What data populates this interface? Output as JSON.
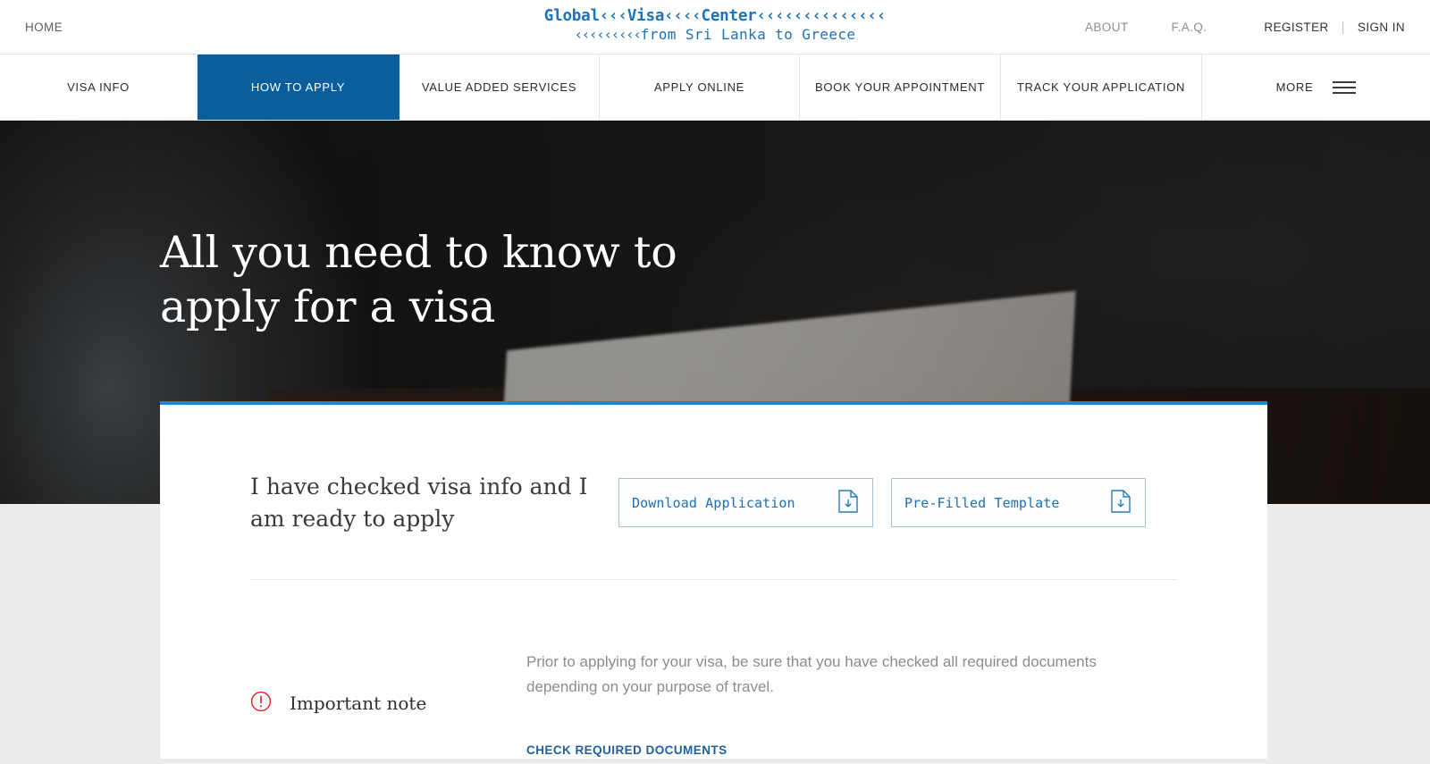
{
  "topbar": {
    "home_label": "HOME",
    "logo": {
      "line1_a": "Global",
      "line1_ch1": "‹‹‹",
      "line1_b": "Visa",
      "line1_ch2": "‹‹‹‹",
      "line1_c": "Center",
      "line1_ch3": "‹‹‹‹‹‹‹‹‹‹‹‹‹‹",
      "line2_ch": "‹‹‹‹‹‹‹‹‹",
      "line2_text": "from Sri Lanka to Greece"
    },
    "about_label": "ABOUT",
    "faq_label": "F.A.Q.",
    "register_label": "REGISTER",
    "separator": "|",
    "signin_label": "SIGN IN",
    "accent_color": "#1f72b5"
  },
  "mainnav": {
    "items": [
      {
        "label": "VISA INFO",
        "active": false
      },
      {
        "label": "HOW TO APPLY",
        "active": true
      },
      {
        "label": "VALUE ADDED SERVICES",
        "active": false
      },
      {
        "label": "APPLY ONLINE",
        "active": false
      },
      {
        "label": "BOOK YOUR APPOINTMENT",
        "active": false
      },
      {
        "label": "TRACK YOUR APPLICATION",
        "active": false
      }
    ],
    "more_label": "MORE",
    "active_color": "#0a5e9e"
  },
  "hero": {
    "title_line1": "All you need to know to",
    "title_line2": "apply for a visa"
  },
  "card": {
    "accent_color": "#1a86d8",
    "lead_line1": "I have checked visa info and I",
    "lead_line2": "am ready to apply",
    "buttons": [
      {
        "label": "Download Application",
        "icon": "document-download-icon"
      },
      {
        "label": "Pre-Filled Template",
        "icon": "document-download-icon"
      }
    ],
    "note": {
      "icon": "alert-circle-icon",
      "icon_color": "#e0282e",
      "title": "Important note",
      "body": "Prior to applying for your visa, be sure that you have checked all required documents depending on your purpose of travel.",
      "link_label": "CHECK REQUIRED DOCUMENTS",
      "link_color": "#1f5f9e"
    }
  }
}
